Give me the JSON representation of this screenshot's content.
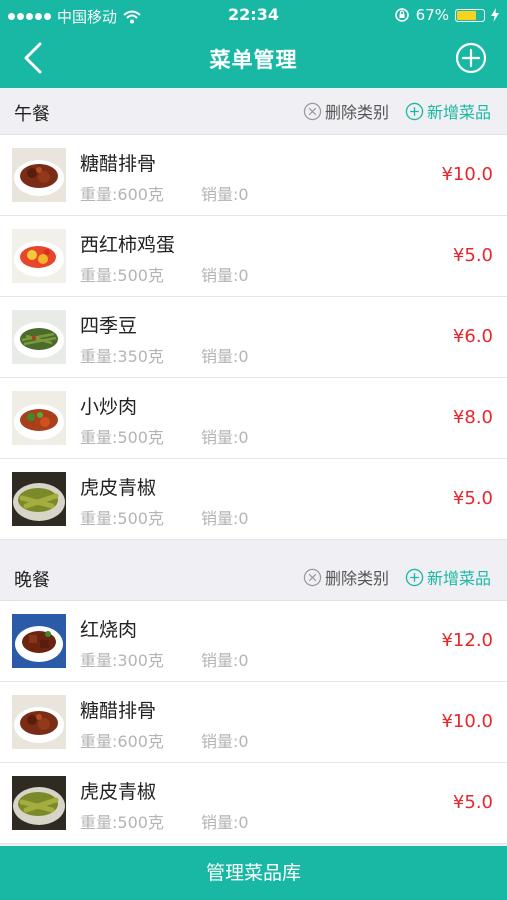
{
  "statusbar": {
    "carrier": "中国移动",
    "time": "22:34",
    "battery": "67%",
    "battery_level": 0.67
  },
  "nav": {
    "title": "菜单管理",
    "back_icon": "chevron-left-icon",
    "add_icon": "plus-circle-icon"
  },
  "actions": {
    "delete_category": "删除类别",
    "add_dish": "新增菜品"
  },
  "categories": [
    {
      "name": "午餐",
      "items": [
        {
          "name": "糖醋排骨",
          "weight": "重量:600克",
          "sales": "销量:0",
          "price": "¥10.0"
        },
        {
          "name": "西红柿鸡蛋",
          "weight": "重量:500克",
          "sales": "销量:0",
          "price": "¥5.0"
        },
        {
          "name": "四季豆",
          "weight": "重量:350克",
          "sales": "销量:0",
          "price": "¥6.0"
        },
        {
          "name": "小炒肉",
          "weight": "重量:500克",
          "sales": "销量:0",
          "price": "¥8.0"
        },
        {
          "name": "虎皮青椒",
          "weight": "重量:500克",
          "sales": "销量:0",
          "price": "¥5.0"
        }
      ]
    },
    {
      "name": "晚餐",
      "items": [
        {
          "name": "红烧肉",
          "weight": "重量:300克",
          "sales": "销量:0",
          "price": "¥12.0"
        },
        {
          "name": "糖醋排骨",
          "weight": "重量:600克",
          "sales": "销量:0",
          "price": "¥10.0"
        },
        {
          "name": "虎皮青椒",
          "weight": "重量:500克",
          "sales": "销量:0",
          "price": "¥5.0"
        }
      ]
    }
  ],
  "footer": {
    "label": "管理菜品库"
  },
  "colors": {
    "accent": "#19b8a4",
    "price": "#e8262b"
  }
}
